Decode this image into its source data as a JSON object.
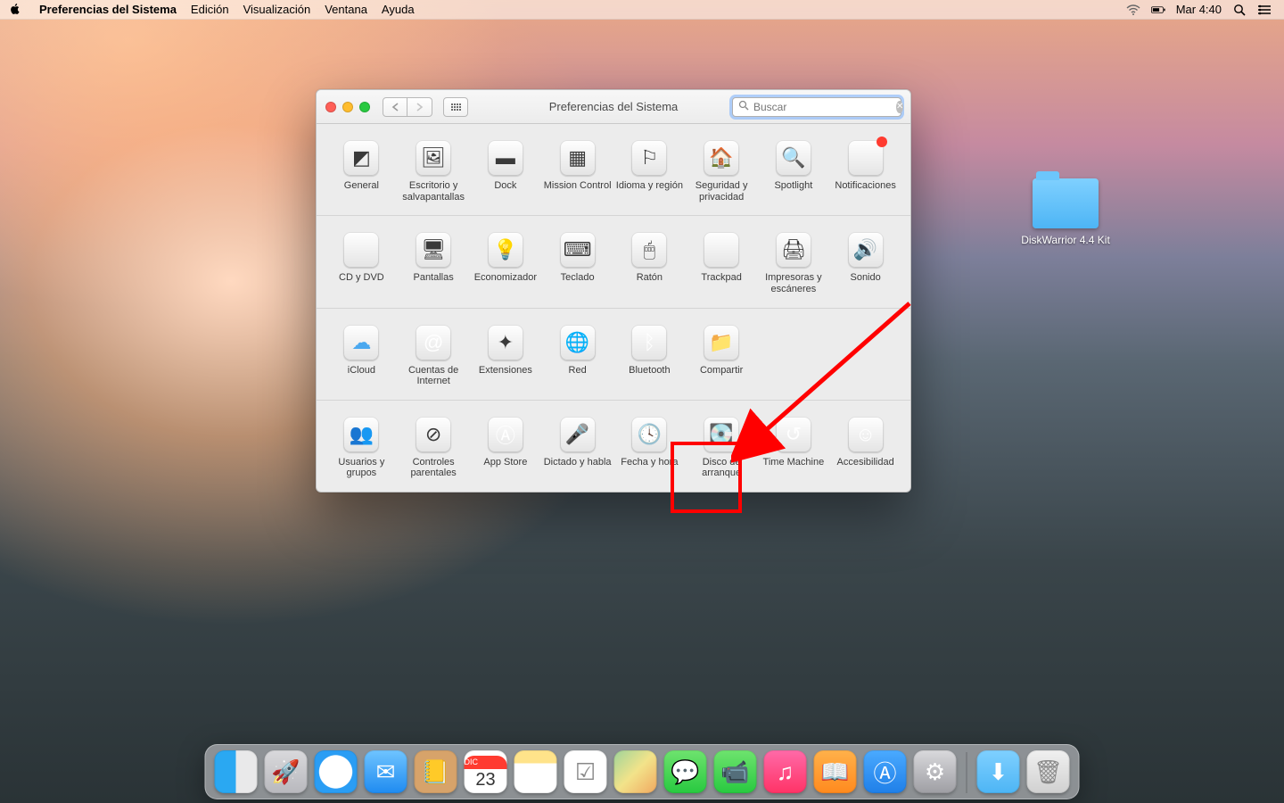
{
  "menubar": {
    "app": "Preferencias del Sistema",
    "items": [
      "Edición",
      "Visualización",
      "Ventana",
      "Ayuda"
    ],
    "clock": "Mar 4:40"
  },
  "desktop": {
    "folder1": "DiskWarrior 4.4 Kit"
  },
  "window": {
    "title": "Preferencias del Sistema",
    "search_placeholder": "Buscar"
  },
  "prefs": {
    "r1": [
      {
        "id": "general",
        "label": "General",
        "glyph": "◩"
      },
      {
        "id": "desktop",
        "label": "Escritorio y salvapantallas",
        "glyph": "🖼"
      },
      {
        "id": "dock",
        "label": "Dock",
        "glyph": "▬"
      },
      {
        "id": "mission",
        "label": "Mission Control",
        "glyph": "▦"
      },
      {
        "id": "lang",
        "label": "Idioma y región",
        "glyph": "⚐"
      },
      {
        "id": "sec",
        "label": "Seguridad y privacidad",
        "glyph": "🏠"
      },
      {
        "id": "spot",
        "label": "Spotlight",
        "glyph": "🔍"
      },
      {
        "id": "notif",
        "label": "Notificaciones",
        "glyph": "◉"
      }
    ],
    "r2": [
      {
        "id": "cd",
        "label": "CD y DVD",
        "glyph": "◉"
      },
      {
        "id": "disp",
        "label": "Pantallas",
        "glyph": "🖥"
      },
      {
        "id": "energy",
        "label": "Economizador",
        "glyph": "💡"
      },
      {
        "id": "keyb",
        "label": "Teclado",
        "glyph": "⌨"
      },
      {
        "id": "mouse",
        "label": "Ratón",
        "glyph": "🖱"
      },
      {
        "id": "track",
        "label": "Trackpad",
        "glyph": "▭"
      },
      {
        "id": "print",
        "label": "Impresoras y escáneres",
        "glyph": "🖨"
      },
      {
        "id": "sound",
        "label": "Sonido",
        "glyph": "🔊"
      }
    ],
    "r3": [
      {
        "id": "icloud",
        "label": "iCloud",
        "glyph": "☁"
      },
      {
        "id": "intacc",
        "label": "Cuentas de Internet",
        "glyph": "@"
      },
      {
        "id": "ext",
        "label": "Extensiones",
        "glyph": "✦"
      },
      {
        "id": "net",
        "label": "Red",
        "glyph": "🌐"
      },
      {
        "id": "bt",
        "label": "Bluetooth",
        "glyph": "ᛒ"
      },
      {
        "id": "share",
        "label": "Compartir",
        "glyph": "📁"
      }
    ],
    "r4": [
      {
        "id": "users",
        "label": "Usuarios y grupos",
        "glyph": "👥"
      },
      {
        "id": "parent",
        "label": "Controles parentales",
        "glyph": "⊘"
      },
      {
        "id": "appstore",
        "label": "App Store",
        "glyph": "Ⓐ"
      },
      {
        "id": "dict",
        "label": "Dictado y habla",
        "glyph": "🎤"
      },
      {
        "id": "date",
        "label": "Fecha y hora",
        "glyph": "🕓"
      },
      {
        "id": "startup",
        "label": "Disco de arranque",
        "glyph": "💽"
      },
      {
        "id": "tm",
        "label": "Time Machine",
        "glyph": "↺"
      },
      {
        "id": "access",
        "label": "Accesibilidad",
        "glyph": "☺"
      }
    ]
  },
  "calendar": {
    "month": "DIC",
    "day": "23"
  },
  "annotation": {
    "highlighted_pref": "Disco de arranque"
  }
}
